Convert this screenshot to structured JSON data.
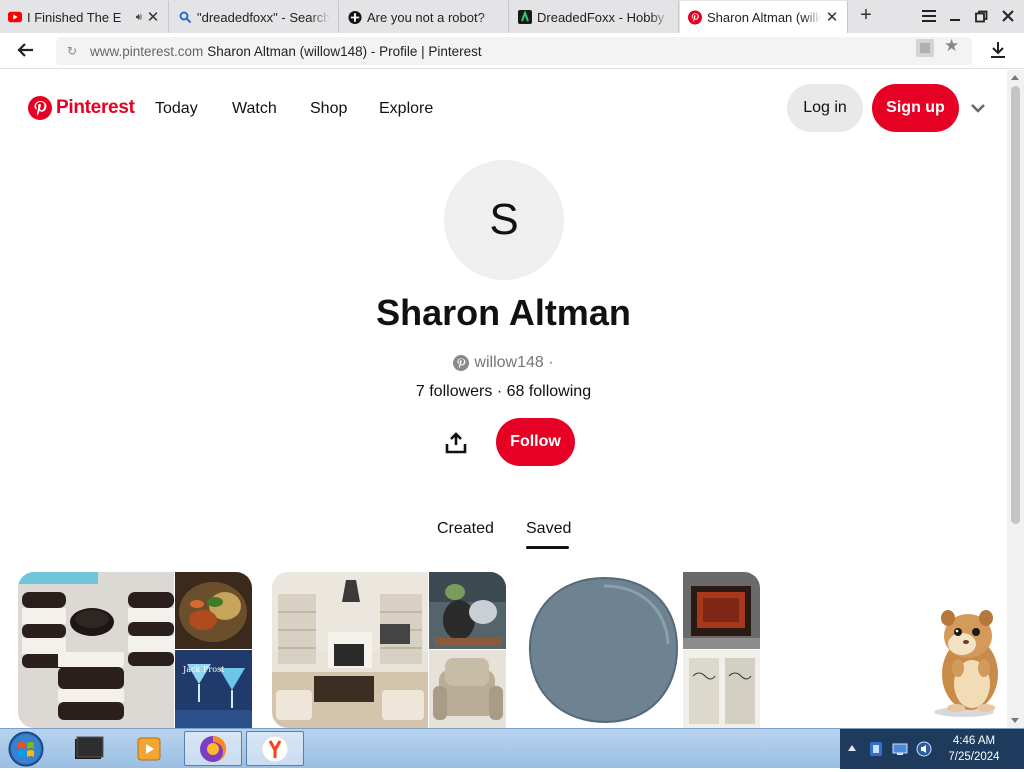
{
  "browser": {
    "tabs": [
      {
        "title": "I Finished The E",
        "icon": "youtube-icon",
        "audio": true
      },
      {
        "title": "\"dreadedfoxx\" - Search",
        "icon": "search-icon"
      },
      {
        "title": "Are you not a robot?",
        "icon": "plus-circle-icon"
      },
      {
        "title": "DreadedFoxx - Hobby",
        "icon": "hobby-icon"
      },
      {
        "title": "Sharon Altman (willow148)",
        "icon": "pinterest-icon",
        "active": true
      }
    ],
    "address": {
      "host": "www.pinterest.com",
      "title": "Sharon Altman (willow148) - Profile | Pinterest"
    }
  },
  "pinterest": {
    "logo_text": "Pinterest",
    "brand_color": "#e60023",
    "nav": [
      "Today",
      "Watch",
      "Shop",
      "Explore"
    ],
    "login_label": "Log in",
    "signup_label": "Sign up"
  },
  "profile": {
    "avatar_letter": "S",
    "name": "Sharon Altman",
    "handle": "willow148 ·",
    "follows": "7 followers · 68 following",
    "follow_label": "Follow",
    "tabs": [
      "Created",
      "Saved"
    ],
    "active_tab": "Saved"
  },
  "taskbar": {
    "time": "4:46 AM",
    "date": "7/25/2024"
  }
}
